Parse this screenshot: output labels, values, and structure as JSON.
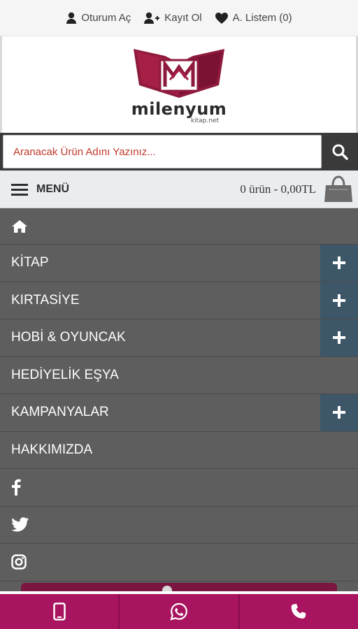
{
  "topbar": {
    "login": "Oturum Aç",
    "register": "Kayıt Ol",
    "wishlist": "A. Listem (0)"
  },
  "logo": {
    "name": "milenyum",
    "domain": "kitap.net",
    "colors": {
      "primary": "#9b1a3f",
      "dark": "#7a1232"
    }
  },
  "search": {
    "placeholder": "Aranacak Ürün Adını Yazınız..."
  },
  "menu_header": {
    "menu_label": "MENÜ",
    "cart_summary": "0 ürün - 0,00TL"
  },
  "menu": {
    "items": [
      {
        "label": "KİTAP",
        "expandable": true
      },
      {
        "label": "KIRTASİYE",
        "expandable": true
      },
      {
        "label": "HOBİ & OYUNCAK",
        "expandable": true
      },
      {
        "label": "HEDİYELİK EŞYA",
        "expandable": false
      },
      {
        "label": "KAMPANYALAR",
        "expandable": true
      },
      {
        "label": "HAKKIMIZDA",
        "expandable": false
      }
    ],
    "social": [
      "facebook-icon",
      "twitter-icon",
      "instagram-icon"
    ]
  },
  "bottom_bar": {
    "buttons": [
      "mobile-phone-icon",
      "whatsapp-icon",
      "phone-icon"
    ],
    "color": "#a8145f"
  }
}
